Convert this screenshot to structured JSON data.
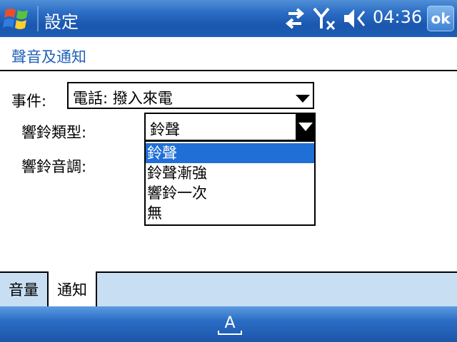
{
  "titlebar": {
    "title": "設定",
    "time": "04:36",
    "ok_label": "ok",
    "icons": [
      "windows-start-icon",
      "connectivity-icon",
      "no-signal-icon",
      "volume-icon"
    ]
  },
  "page": {
    "subtitle": "聲音及通知"
  },
  "form": {
    "event_label": "事件:",
    "event_value": "電話: 撥入來電",
    "ring_type_label": "響鈴類型:",
    "ring_type_value": "鈴聲",
    "ring_tone_label": "響鈴音調:",
    "ring_type_options": [
      "鈴聲",
      "鈴聲漸強",
      "響鈴一次",
      "無"
    ],
    "selected_option": "鈴聲"
  },
  "tabs": [
    {
      "label": "音量",
      "active": false
    },
    {
      "label": "通知",
      "active": true
    }
  ],
  "bottombar": {
    "input_icon": "keyboard-input-icon"
  },
  "colors": {
    "accent": "#1f62b8",
    "selection": "#1f6fd6",
    "tabbar": "#c8def3"
  }
}
